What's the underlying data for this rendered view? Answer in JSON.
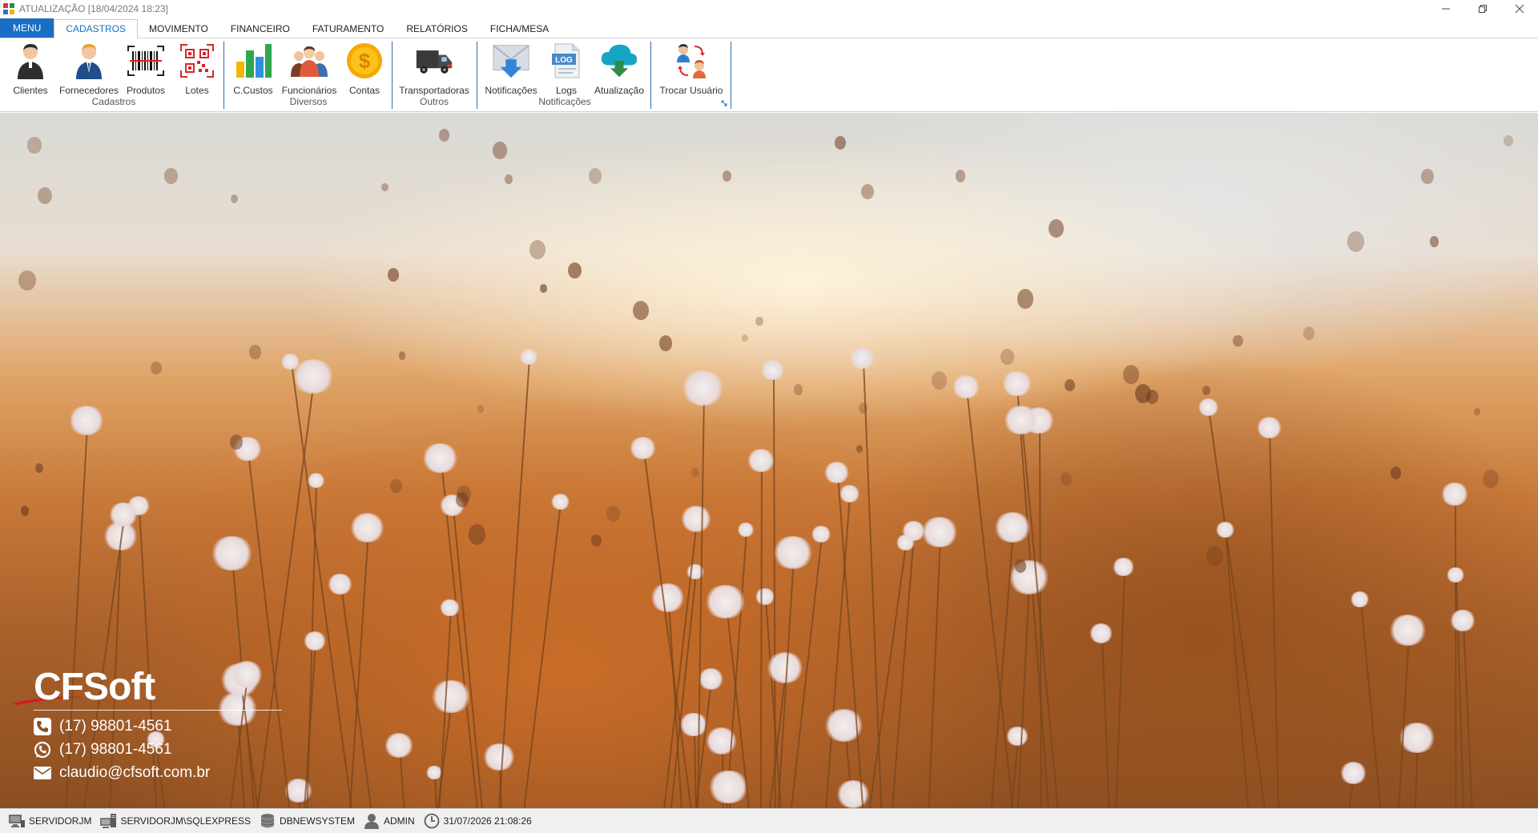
{
  "window": {
    "title": "ATUALIZAÇÃO [18/04/2024 18:23]",
    "controls": [
      "minimize",
      "restore",
      "close"
    ]
  },
  "tabs": [
    {
      "label": "MENU",
      "kind": "menu"
    },
    {
      "label": "CADASTROS",
      "kind": "active"
    },
    {
      "label": "MOVIMENTO",
      "kind": "normal"
    },
    {
      "label": "FINANCEIRO",
      "kind": "normal"
    },
    {
      "label": "FATURAMENTO",
      "kind": "normal"
    },
    {
      "label": "RELATÓRIOS",
      "kind": "normal"
    },
    {
      "label": "FICHA/MESA",
      "kind": "normal"
    }
  ],
  "ribbon": {
    "groups": [
      {
        "title": "Cadastros",
        "buttons": [
          {
            "label": "Clientes",
            "icon": "client-person-icon"
          },
          {
            "label": "Fornecedores",
            "icon": "supplier-person-icon"
          },
          {
            "label": "Produtos",
            "icon": "barcode-icon"
          },
          {
            "label": "Lotes",
            "icon": "qrcode-icon"
          }
        ]
      },
      {
        "title": "Diversos",
        "buttons": [
          {
            "label": "C.Custos",
            "icon": "bar-chart-icon"
          },
          {
            "label": "Funcionários",
            "icon": "employees-icon"
          },
          {
            "label": "Contas",
            "icon": "dollar-coin-icon"
          }
        ]
      },
      {
        "title": "Outros",
        "buttons": [
          {
            "label": "Transportadoras",
            "icon": "truck-icon"
          }
        ]
      },
      {
        "title": "Notificações",
        "buttons": [
          {
            "label": "Notificações",
            "icon": "envelope-download-icon"
          },
          {
            "label": "Logs",
            "icon": "log-file-icon"
          },
          {
            "label": "Atualização",
            "icon": "cloud-update-icon"
          }
        ]
      },
      {
        "title": "",
        "buttons": [
          {
            "label": "Trocar Usuário",
            "icon": "switch-user-icon"
          }
        ]
      }
    ]
  },
  "brand": {
    "logo_text": "CFSoft",
    "phone": "(17) 98801-4561",
    "whatsapp": "(17) 98801-4561",
    "email": "claudio@cfsoft.com.br"
  },
  "status": {
    "server": "SERVIDORJM",
    "instance": "SERVIDORJM\\SQLEXPRESS",
    "database": "DBNEWSYSTEM",
    "user": "ADMIN",
    "datetime": "31/07/2026 21:08:26"
  },
  "colors": {
    "accent": "#1a6fc4",
    "ribbon_separator": "#2b6cb0"
  }
}
